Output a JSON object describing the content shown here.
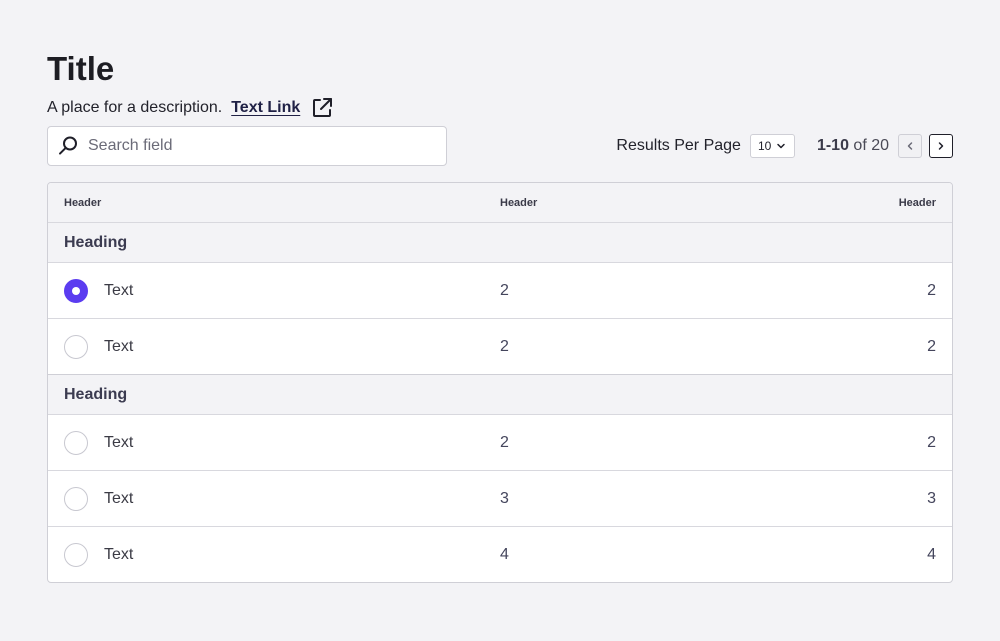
{
  "header": {
    "title": "Title",
    "description": "A place for a description.",
    "link_label": "Text Link"
  },
  "search": {
    "placeholder": "Search field",
    "value": ""
  },
  "pagination": {
    "results_per_page_label": "Results Per Page",
    "per_page_value": "10",
    "range_bold": "1-10",
    "range_rest": " of 20"
  },
  "table": {
    "headers": [
      "Header",
      "Header",
      "Header"
    ],
    "groups": [
      {
        "heading": "Heading",
        "rows": [
          {
            "label": "Text",
            "col2": "2",
            "col3": "2",
            "selected": true
          },
          {
            "label": "Text",
            "col2": "2",
            "col3": "2",
            "selected": false
          }
        ]
      },
      {
        "heading": "Heading",
        "rows": [
          {
            "label": "Text",
            "col2": "2",
            "col3": "2",
            "selected": false
          },
          {
            "label": "Text",
            "col2": "3",
            "col3": "3",
            "selected": false
          },
          {
            "label": "Text",
            "col2": "4",
            "col3": "4",
            "selected": false
          }
        ]
      }
    ]
  },
  "colors": {
    "accent": "#5b3cf0",
    "background": "#f3f3f6",
    "link": "#1f2045"
  },
  "icons": {
    "external": "external-link-icon",
    "search": "search-icon",
    "dropdown": "chevron-down-icon",
    "prev": "chevron-left-icon",
    "next": "chevron-right-icon"
  }
}
